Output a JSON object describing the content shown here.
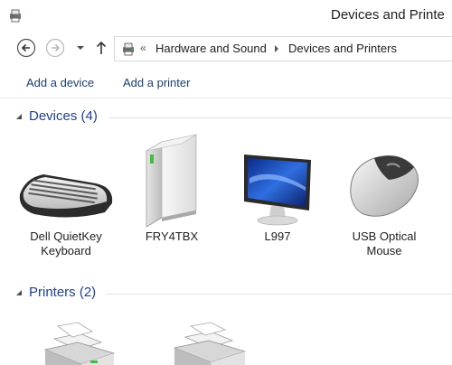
{
  "window": {
    "title": "Devices and Printe"
  },
  "nav": {
    "back_icon": "back-arrow-icon",
    "forward_icon": "forward-arrow-icon",
    "recent_icon": "chevron-down-icon",
    "up_icon": "up-arrow-icon"
  },
  "address": {
    "chevrons": "«",
    "crumbs": [
      "Hardware and Sound",
      "Devices and Printers"
    ]
  },
  "commands": {
    "add_device": "Add a device",
    "add_printer": "Add a printer"
  },
  "groups": {
    "devices": {
      "label": "Devices (4)",
      "items": [
        {
          "name": "Dell QuietKey Keyboard",
          "icon": "keyboard-icon"
        },
        {
          "name": "FRY4TBX",
          "icon": "computer-tower-icon"
        },
        {
          "name": "L997",
          "icon": "monitor-icon"
        },
        {
          "name": "USB Optical Mouse",
          "icon": "mouse-icon"
        }
      ]
    },
    "printers": {
      "label": "Printers (2)",
      "items": [
        {
          "icon": "printer-icon"
        },
        {
          "icon": "printer-icon"
        }
      ]
    }
  },
  "colors": {
    "link": "#1e3f6f",
    "group_header": "#1e3f8f",
    "rule": "#e2e2e2"
  }
}
